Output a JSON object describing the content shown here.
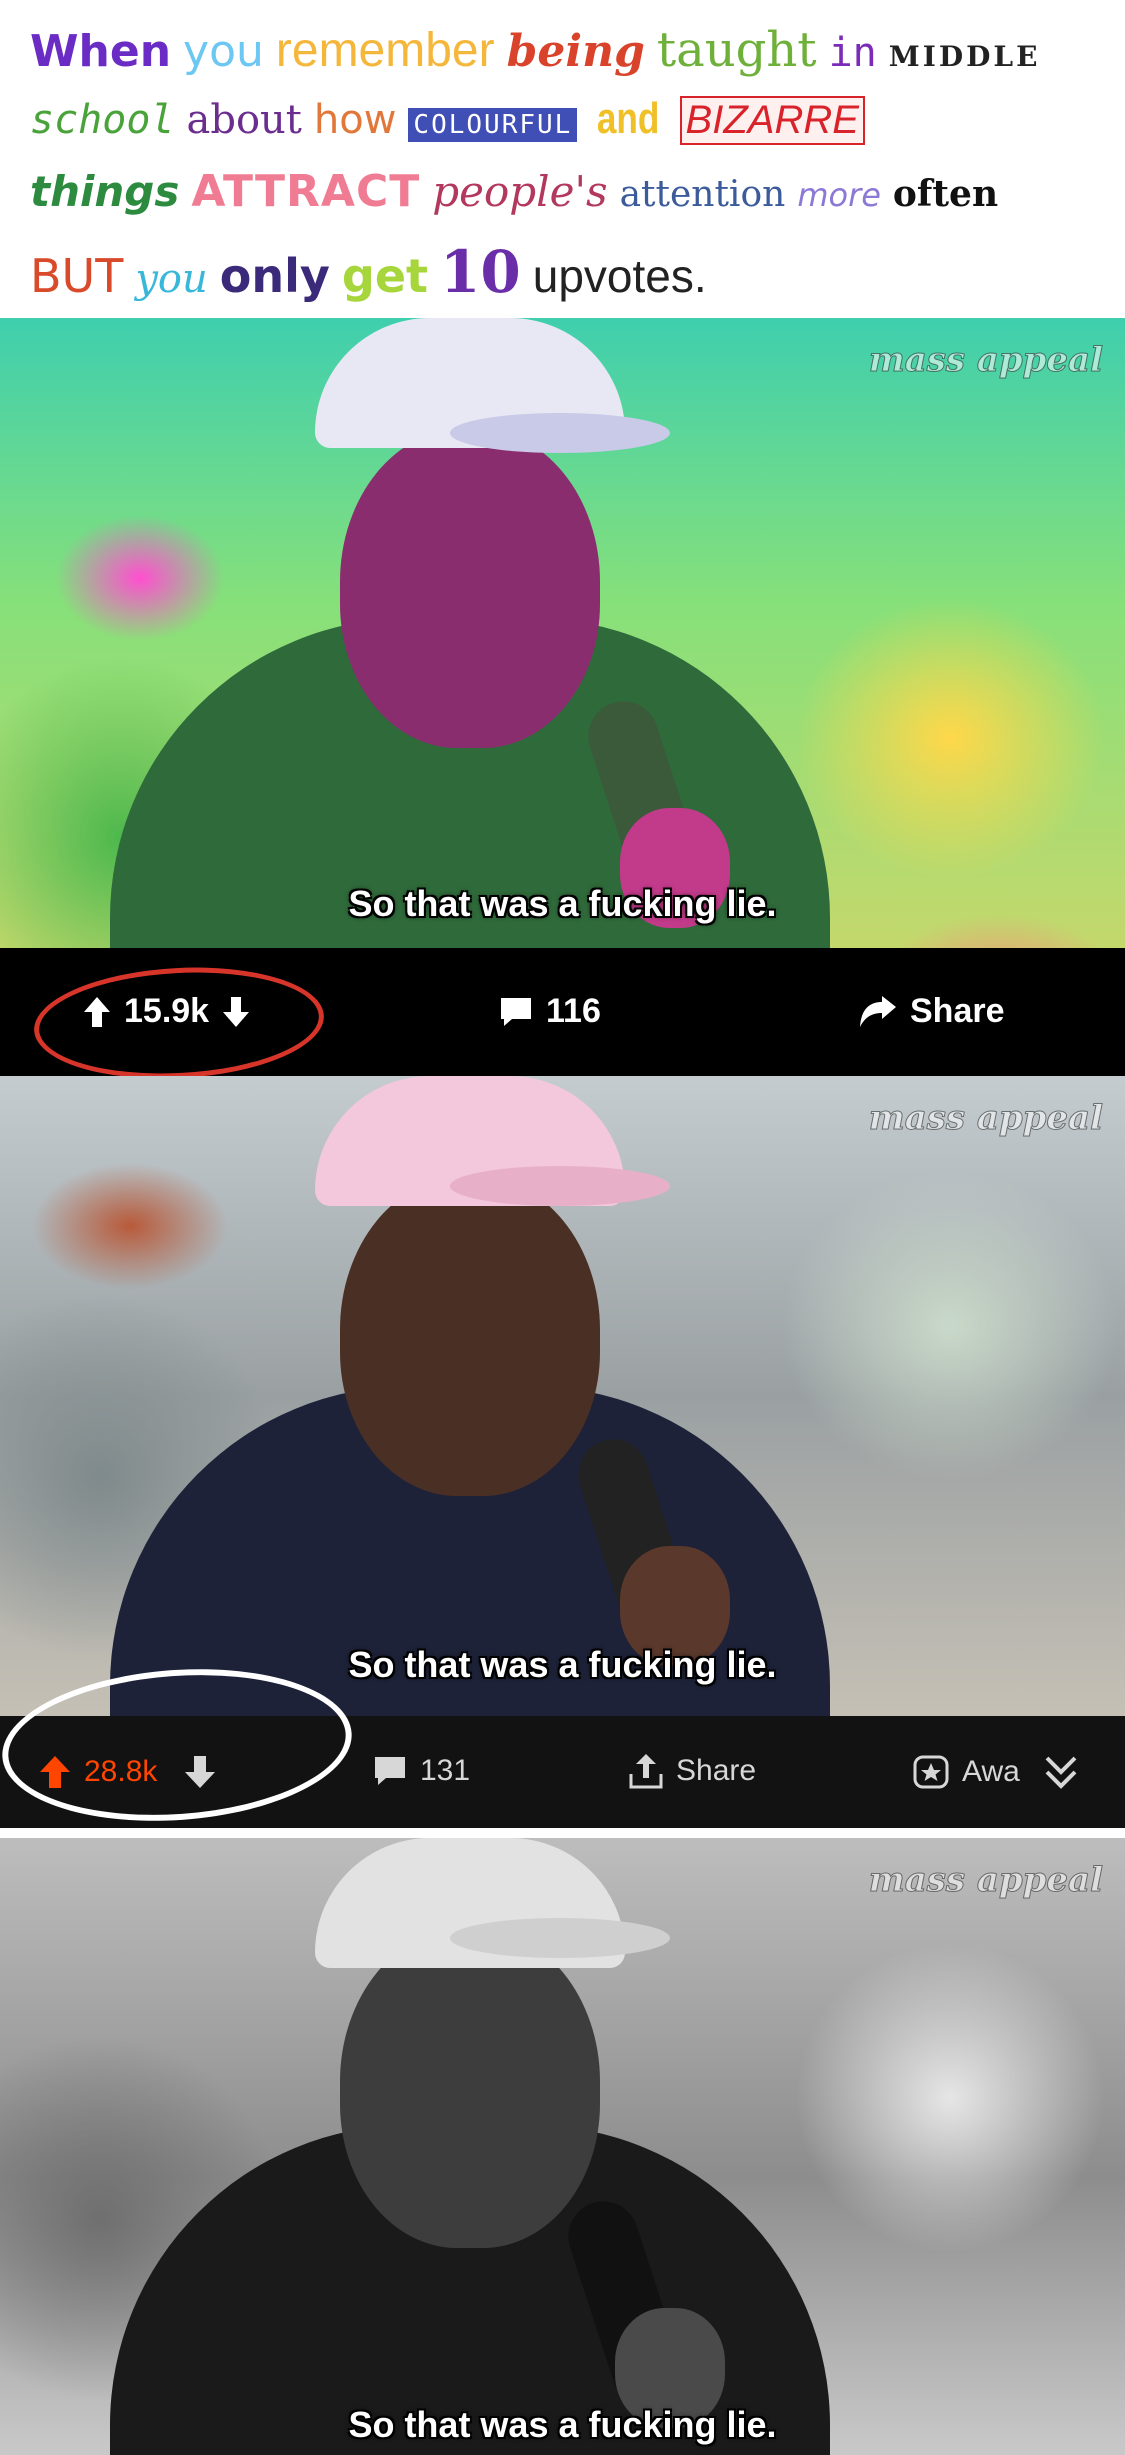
{
  "caption": {
    "line1": [
      "When",
      "you",
      "remember",
      "being",
      "taught",
      "in",
      "MIDDLE"
    ],
    "line2": [
      "school",
      "about",
      "how",
      "COLOURFUL",
      "and",
      "BIZARRE"
    ],
    "line3": [
      "things",
      "ATTRACT",
      "people's",
      "attention",
      "more",
      "often"
    ],
    "line4": [
      "BUT",
      "you",
      "only",
      "get",
      "10",
      "upvotes."
    ]
  },
  "frames": [
    {
      "subtitle": "So that was a fucking lie.",
      "watermark": "mass appeal"
    },
    {
      "subtitle": "So that was a fucking lie.",
      "watermark": "mass appeal"
    },
    {
      "subtitle": "So that was a fucking lie.",
      "watermark": "mass appeal"
    }
  ],
  "bar1": {
    "upvotes": "15.9k",
    "comments": "116",
    "share": "Share"
  },
  "bar2": {
    "upvotes": "28.8k",
    "comments": "131",
    "share": "Share",
    "award": "Awa"
  },
  "colors": {
    "upvote_orange": "#ff4500",
    "red_circle": "#d8352a",
    "white_circle": "#ffffff"
  },
  "icons": [
    "upvote-arrow-icon",
    "downvote-arrow-icon",
    "comment-icon",
    "share-arrow-icon",
    "share-upload-icon",
    "award-icon",
    "chevrons-down-icon"
  ]
}
